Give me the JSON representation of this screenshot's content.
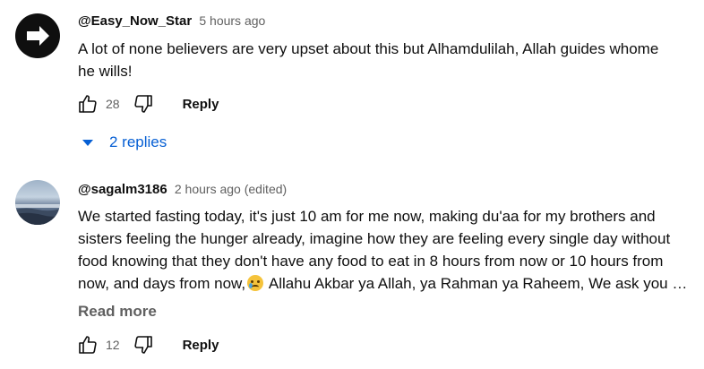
{
  "comments": [
    {
      "author": "@Easy_Now_Star",
      "time": "5 hours ago",
      "avatar_icon": "arrow-right-icon",
      "text_lines": [
        "A lot of none believers are very upset about this but Alhamdulilah, Allah guides whome",
        "he wills!"
      ],
      "likes": "28",
      "reply_label": "Reply",
      "replies_label": "2 replies"
    },
    {
      "author": "@sagalm3186",
      "time": "2 hours ago (edited)",
      "avatar_icon": "landscape-photo",
      "text_lines": [
        "We started fasting today, it's just 10 am for me now, making du'aa for my brothers and",
        "sisters feeling the hunger already, imagine how they are feeling every single day without",
        "food knowing that they don't have any food to eat in 8 hours from now or 10 hours from",
        "now, and days from now,"
      ],
      "text_line4_after_emoji": " Allahu Akbar ya Allah, ya Rahman ya Raheem, We ask you …",
      "emoji": "crying-face-emoji",
      "read_more": "Read more",
      "likes": "12",
      "reply_label": "Reply"
    }
  ],
  "colors": {
    "link": "#065fd4",
    "secondary_text": "#606060",
    "primary_text": "#0f0f0f"
  }
}
